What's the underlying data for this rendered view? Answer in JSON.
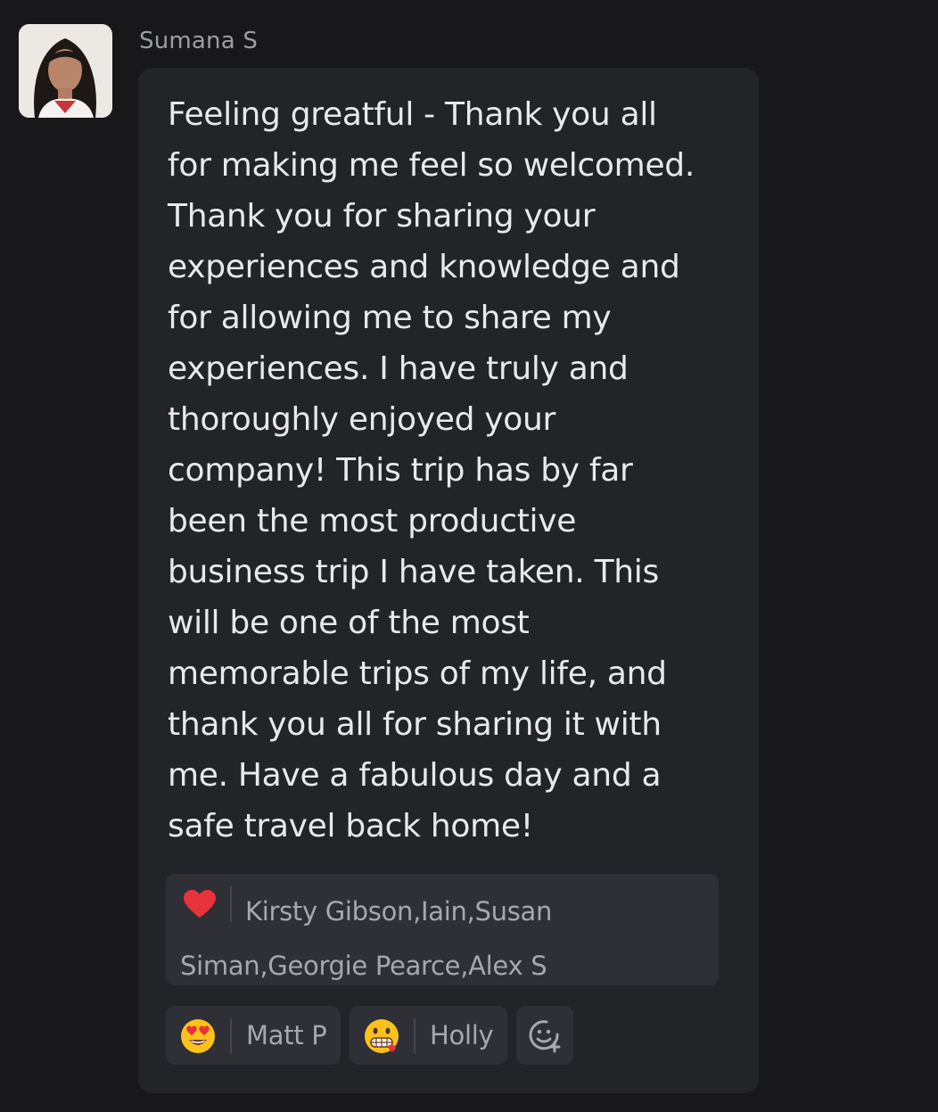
{
  "message": {
    "sender": "Sumana S",
    "text": "Feeling greatful - Thank you all\nfor making me feel so welcomed.\nThank you for sharing your\nexperiences and knowledge and\nfor allowing me to share my\nexperiences.  I have truly and\nthoroughly enjoyed your\ncompany! This trip has by far\nbeen the most productive\nbusiness trip I have taken. This\nwill be one of the most\nmemorable trips of my life, and\nthank you all for sharing it with\nme. Have a fabulous day and a\nsafe travel back home!"
  },
  "reactions": [
    {
      "icon": "red-heart-emoji",
      "users": "Kirsty Gibson,Iain,Susan Siman,Georgie Pearce,Alex S"
    },
    {
      "icon": "heart-eyes-emoji",
      "users": "Matt P"
    },
    {
      "icon": "grimacing-emoji",
      "users": "Holly"
    }
  ],
  "add_reaction": {
    "icon": "add-reaction-icon"
  },
  "colors": {
    "background": "#18181a",
    "bubble": "#232428",
    "chip": "#2e3036",
    "text": "#e8e9ec",
    "muted": "#a6a8ae",
    "heart": "#e8323c"
  }
}
